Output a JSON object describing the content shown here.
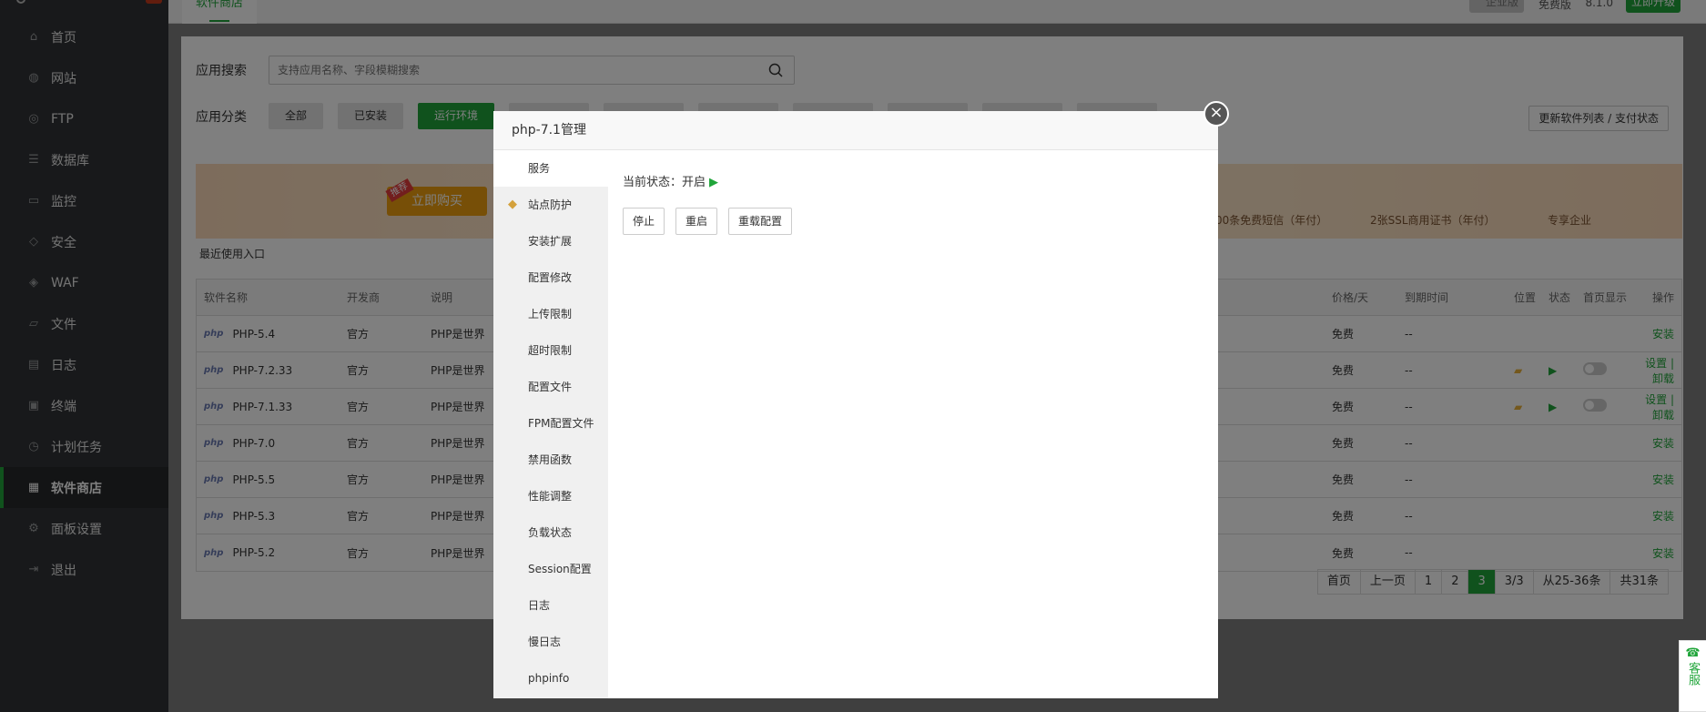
{
  "sidebar": {
    "items": [
      {
        "label": "首页",
        "icon": "home-icon"
      },
      {
        "label": "网站",
        "icon": "globe-icon"
      },
      {
        "label": "FTP",
        "icon": "ftp-icon"
      },
      {
        "label": "数据库",
        "icon": "database-icon"
      },
      {
        "label": "监控",
        "icon": "monitor-icon"
      },
      {
        "label": "安全",
        "icon": "shield-icon"
      },
      {
        "label": "WAF",
        "icon": "waf-icon"
      },
      {
        "label": "文件",
        "icon": "folder-icon"
      },
      {
        "label": "日志",
        "icon": "log-icon"
      },
      {
        "label": "终端",
        "icon": "terminal-icon"
      },
      {
        "label": "计划任务",
        "icon": "clock-icon"
      },
      {
        "label": "软件商店",
        "icon": "grid-icon"
      },
      {
        "label": "面板设置",
        "icon": "gear-icon"
      },
      {
        "label": "退出",
        "icon": "logout-icon"
      }
    ],
    "active_index": 11
  },
  "topbar": {
    "tab": "软件商店",
    "edition": "企业版",
    "free_label": "免费版",
    "version": "8.1.0",
    "upgrade": "立即升级"
  },
  "search": {
    "label": "应用搜索",
    "placeholder": "支持应用名称、字段模糊搜索"
  },
  "categories": {
    "label": "应用分类",
    "items": [
      "全部",
      "已安装",
      "运行环境"
    ],
    "active_index": 2,
    "refresh": "更新软件列表 / 支付状态"
  },
  "banner": {
    "tag": "推荐",
    "buy": "立即购买",
    "perks": [
      "00条免费短信（年付）",
      "2张SSL商用证书（年付）",
      "专享企业"
    ]
  },
  "recent": "最近使用入口",
  "table": {
    "headers": {
      "name": "软件名称",
      "dev": "开发商",
      "desc": "说明",
      "price": "价格/天",
      "expire": "到期时间",
      "pos": "位置",
      "status": "状态",
      "home": "首页显示",
      "op": "操作"
    },
    "rows": [
      {
        "name": "PHP-5.4",
        "dev": "官方",
        "desc": "PHP是世界",
        "price": "免费",
        "expire": "--",
        "op": "安装"
      },
      {
        "name": "PHP-7.2.33",
        "dev": "官方",
        "desc": "PHP是世界",
        "price": "免费",
        "expire": "--",
        "op": "设置 | 卸载"
      },
      {
        "name": "PHP-7.1.33",
        "dev": "官方",
        "desc": "PHP是世界",
        "price": "免费",
        "expire": "--",
        "op": "设置 | 卸载"
      },
      {
        "name": "PHP-7.0",
        "dev": "官方",
        "desc": "PHP是世界",
        "price": "免费",
        "expire": "--",
        "op": "安装"
      },
      {
        "name": "PHP-5.5",
        "dev": "官方",
        "desc": "PHP是世界",
        "price": "免费",
        "expire": "--",
        "op": "安装"
      },
      {
        "name": "PHP-5.3",
        "dev": "官方",
        "desc": "PHP是世界",
        "price": "免费",
        "expire": "--",
        "op": "安装"
      },
      {
        "name": "PHP-5.2",
        "dev": "官方",
        "desc": "PHP是世界",
        "price": "免费",
        "expire": "--",
        "op": "安装"
      }
    ]
  },
  "pager": [
    "首页",
    "上一页",
    "1",
    "2",
    "3",
    "3/3",
    "从25-36条",
    "共31条"
  ],
  "pager_current": "3",
  "kefu": "客服",
  "modal": {
    "title": "php-7.1管理",
    "menu": [
      "服务",
      "站点防护",
      "安装扩展",
      "配置修改",
      "上传限制",
      "超时限制",
      "配置文件",
      "FPM配置文件",
      "禁用函数",
      "性能调整",
      "负载状态",
      "Session配置",
      "日志",
      "慢日志",
      "phpinfo"
    ],
    "status_label": "当前状态：",
    "status_value": "开启",
    "buttons": [
      "停止",
      "重启",
      "重载配置"
    ]
  }
}
